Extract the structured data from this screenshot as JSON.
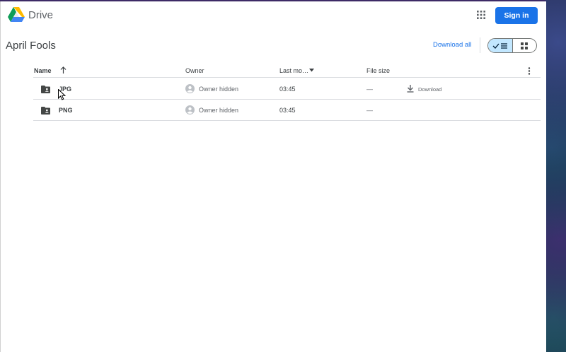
{
  "app": {
    "name": "Drive"
  },
  "header": {
    "signin_label": "Sign in"
  },
  "folder": {
    "title": "April Fools"
  },
  "toolbar": {
    "download_all_label": "Download all"
  },
  "columns": {
    "name": "Name",
    "owner": "Owner",
    "last_modified": "Last mo…",
    "file_size": "File size"
  },
  "rows": [
    {
      "name": "JPG",
      "owner": "Owner hidden",
      "modified": "03:45",
      "size": "—",
      "download_label": "Download"
    },
    {
      "name": "PNG",
      "owner": "Owner hidden",
      "modified": "03:45",
      "size": "—"
    }
  ],
  "colors": {
    "accent": "#1a73e8",
    "toggle_active": "#c2e7ff"
  }
}
